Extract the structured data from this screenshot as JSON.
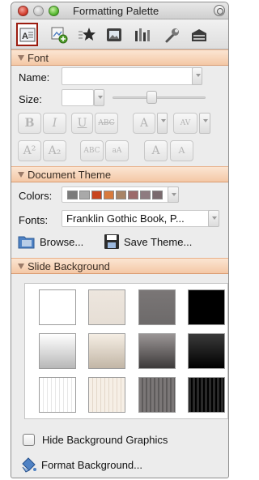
{
  "window": {
    "title": "Formatting Palette"
  },
  "toolbar": {
    "tools": [
      {
        "name": "text-box-tool",
        "label": ""
      },
      {
        "name": "add-objects-tool",
        "label": ""
      },
      {
        "name": "bullets-tool",
        "label": ""
      },
      {
        "name": "picture-tool",
        "label": ""
      },
      {
        "name": "chart-tool",
        "label": ""
      },
      {
        "name": "wrench-tool",
        "label": ""
      },
      {
        "name": "toolbox-tool",
        "label": ""
      }
    ]
  },
  "font_section": {
    "title": "Font",
    "name_label": "Name:",
    "name_value": "",
    "size_label": "Size:",
    "size_value": "",
    "buttons": {
      "bold": "B",
      "italic": "I",
      "underline": "U",
      "strikethrough": "ABC",
      "font_color": "A",
      "char_spacing": "AV",
      "superscript": "A²",
      "subscript": "A₂",
      "small_caps": "ABC",
      "all_caps": "aA",
      "grow_font": "A",
      "shrink_font": "A"
    }
  },
  "theme_section": {
    "title": "Document Theme",
    "colors_label": "Colors:",
    "theme_colors": [
      "#7b7b7b",
      "#a9a9a9",
      "#c8451f",
      "#d87a3c",
      "#a88466",
      "#9c6a6a",
      "#8e7b80",
      "#7a6a6e"
    ],
    "fonts_label": "Fonts:",
    "fonts_value": "Franklin Gothic Book, P...",
    "browse_label": "Browse...",
    "save_theme_label": "Save Theme..."
  },
  "background_section": {
    "title": "Slide Background",
    "swatches": [
      "linear-gradient(#ffffff,#ffffff)",
      "linear-gradient(#ede6de,#e6ded5)",
      "linear-gradient(#7a7676,#6d6a6a)",
      "linear-gradient(#000000,#000000)",
      "linear-gradient(#ffffff,#b8b8b8)",
      "linear-gradient(#f5eee4,#c2b6a6)",
      "linear-gradient(#9a9595,#3d3a3a)",
      "linear-gradient(#3a3a3a,#000000)",
      "repeating-linear-gradient(90deg,#ffffff 0 4px,#e7e7e7 4px 5px)",
      "repeating-linear-gradient(90deg,#f6efe6 0 4px,#e3d7c9 4px 5px)",
      "repeating-linear-gradient(90deg,#7b7777 0 3px,#5e5b5b 3px 5px)",
      "repeating-linear-gradient(90deg,#2a2a2a 0 3px,#000000 3px 5px)"
    ],
    "hide_graphics_label": "Hide Background Graphics",
    "hide_graphics_checked": false,
    "format_background_label": "Format Background..."
  },
  "colors": {
    "section_header": "#f4c8a6",
    "active_tool_border": "#9b1c10"
  }
}
